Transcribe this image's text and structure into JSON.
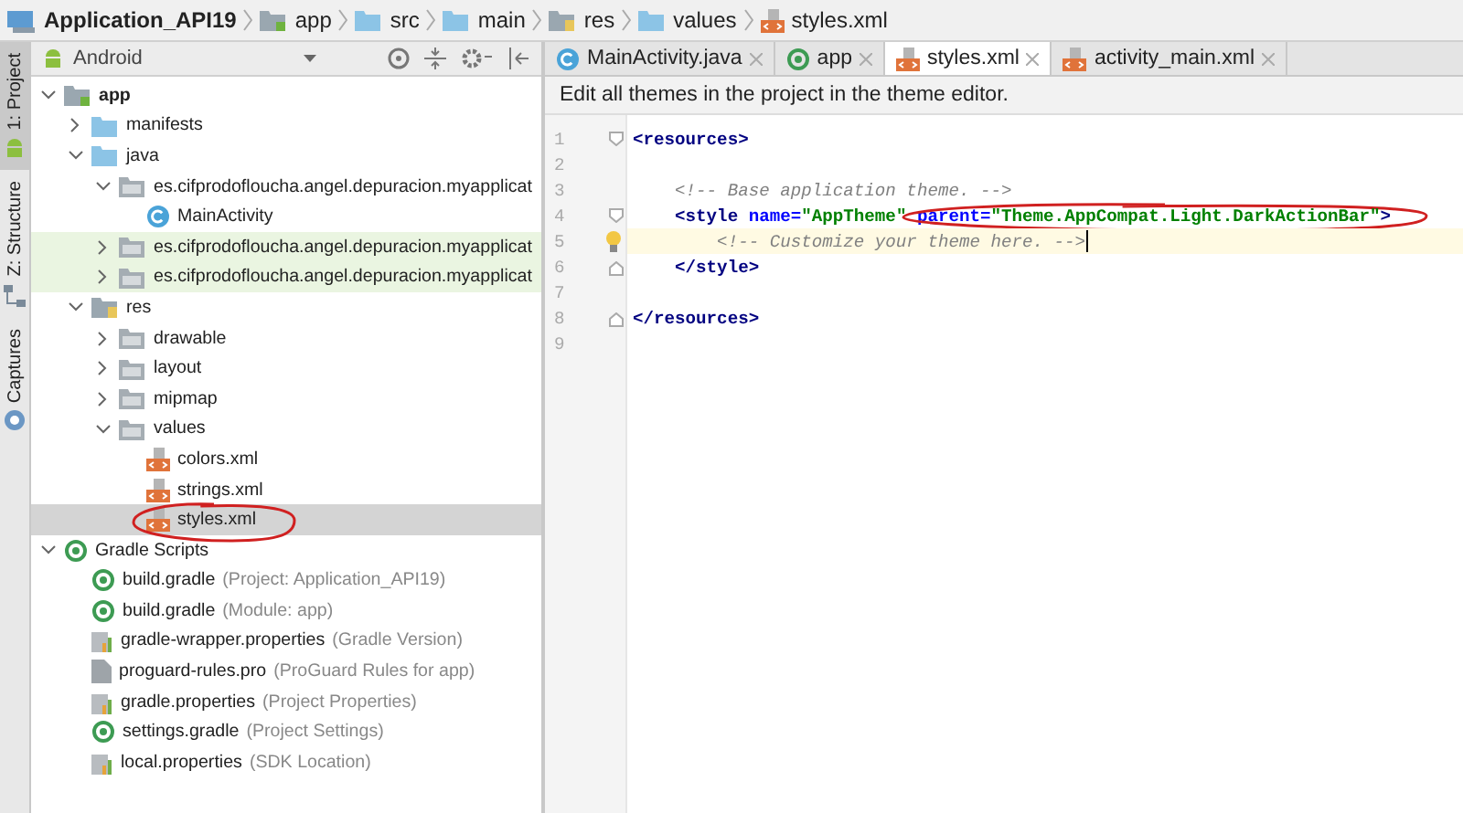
{
  "breadcrumb": [
    {
      "label": "Application_API19",
      "kind": "project"
    },
    {
      "label": "app",
      "kind": "module"
    },
    {
      "label": "src",
      "kind": "folder"
    },
    {
      "label": "main",
      "kind": "folder"
    },
    {
      "label": "res",
      "kind": "res"
    },
    {
      "label": "values",
      "kind": "folder"
    },
    {
      "label": "styles.xml",
      "kind": "xml"
    }
  ],
  "tool_strip": [
    {
      "label": "1: Project",
      "kind": "android",
      "selected": true
    },
    {
      "label": "Z: Structure",
      "kind": "structure",
      "selected": false
    },
    {
      "label": "Captures",
      "kind": "captures",
      "selected": false
    }
  ],
  "project_panel": {
    "view": "Android",
    "tree": [
      {
        "label": "app",
        "kind": "module",
        "bold": true,
        "expanded": true,
        "selected": false,
        "children": [
          {
            "label": "manifests",
            "kind": "folder",
            "expanded": false,
            "selected": false
          },
          {
            "label": "java",
            "kind": "folder",
            "expanded": true,
            "selected": false,
            "children": [
              {
                "label": "es.cifprodofloucha.angel.depuracion.myapplicat",
                "kind": "package",
                "expanded": true,
                "selected": false,
                "children": [
                  {
                    "label": "MainActivity",
                    "kind": "class",
                    "selected": false
                  }
                ]
              },
              {
                "label": "es.cifprodofloucha.angel.depuracion.myapplicat",
                "kind": "package",
                "expanded": false,
                "selected": false,
                "highlight": true
              },
              {
                "label": "es.cifprodofloucha.angel.depuracion.myapplicat",
                "kind": "package",
                "expanded": false,
                "selected": false,
                "highlight": true
              }
            ]
          },
          {
            "label": "res",
            "kind": "res",
            "expanded": true,
            "selected": false,
            "children": [
              {
                "label": "drawable",
                "kind": "package",
                "expanded": false,
                "selected": false
              },
              {
                "label": "layout",
                "kind": "package",
                "expanded": false,
                "selected": false
              },
              {
                "label": "mipmap",
                "kind": "package",
                "expanded": false,
                "selected": false
              },
              {
                "label": "values",
                "kind": "package",
                "expanded": true,
                "selected": false,
                "children": [
                  {
                    "label": "colors.xml",
                    "kind": "xml",
                    "selected": false
                  },
                  {
                    "label": "strings.xml",
                    "kind": "xml",
                    "selected": false
                  },
                  {
                    "label": "styles.xml",
                    "kind": "xml",
                    "selected": true,
                    "circled": true
                  }
                ]
              }
            ]
          }
        ]
      },
      {
        "label": "Gradle Scripts",
        "kind": "gradle",
        "expanded": true,
        "selected": false,
        "children": [
          {
            "label": "build.gradle",
            "detail": "(Project: Application_API19)",
            "kind": "gradle",
            "selected": false
          },
          {
            "label": "build.gradle",
            "detail": "(Module: app)",
            "kind": "gradle",
            "selected": false
          },
          {
            "label": "gradle-wrapper.properties",
            "detail": "(Gradle Version)",
            "kind": "properties",
            "selected": false
          },
          {
            "label": "proguard-rules.pro",
            "detail": "(ProGuard Rules for app)",
            "kind": "file",
            "selected": false
          },
          {
            "label": "gradle.properties",
            "detail": "(Project Properties)",
            "kind": "properties",
            "selected": false
          },
          {
            "label": "settings.gradle",
            "detail": "(Project Settings)",
            "kind": "gradle",
            "selected": false
          },
          {
            "label": "local.properties",
            "detail": "(SDK Location)",
            "kind": "properties",
            "selected": false
          }
        ]
      }
    ]
  },
  "editor": {
    "tabs": [
      {
        "label": "MainActivity.java",
        "kind": "class",
        "selected": false
      },
      {
        "label": "app",
        "kind": "gradle",
        "selected": false
      },
      {
        "label": "styles.xml",
        "kind": "xml",
        "selected": true
      },
      {
        "label": "activity_main.xml",
        "kind": "xml",
        "selected": false
      }
    ],
    "banner": "Edit all themes in the project in the theme editor.",
    "lines": [
      {
        "number": "1",
        "kind": "fold-start",
        "segments": [
          {
            "kind": "tag",
            "text": "<resources>"
          }
        ]
      },
      {
        "number": "2",
        "kind": "plain"
      },
      {
        "number": "3",
        "kind": "plain",
        "segments": [
          {
            "kind": "comment",
            "text": "    <!-- Base application theme. -->"
          }
        ]
      },
      {
        "number": "4",
        "kind": "fold-start",
        "segments": [
          {
            "kind": "tag",
            "text": "    <style"
          },
          {
            "kind": "attr",
            "text": " name="
          },
          {
            "kind": "str",
            "text": "\"AppTheme\""
          },
          {
            "kind": "attr",
            "text": " parent=",
            "circled": true
          },
          {
            "kind": "str",
            "text": "\"Theme.AppCompat.Light.DarkActionBar\""
          },
          {
            "kind": "tag",
            "text": ">"
          }
        ]
      },
      {
        "number": "5",
        "kind": "plain",
        "current": true,
        "bulb": true,
        "segments": [
          {
            "kind": "comment",
            "text": "        <!-- Customize your theme here. -->"
          }
        ]
      },
      {
        "number": "6",
        "kind": "fold-end",
        "segments": [
          {
            "kind": "tag",
            "text": "    </style>"
          }
        ]
      },
      {
        "number": "7",
        "kind": "plain"
      },
      {
        "number": "8",
        "kind": "fold-end",
        "segments": [
          {
            "kind": "tag",
            "text": "</resources>"
          }
        ]
      },
      {
        "number": "9",
        "kind": "plain"
      }
    ]
  }
}
